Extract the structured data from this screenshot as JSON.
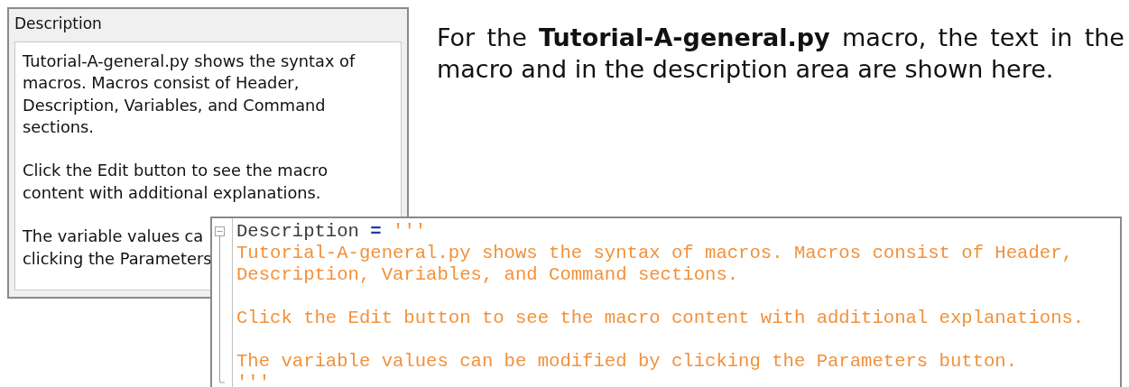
{
  "description_panel": {
    "title": "Description",
    "paragraphs": [
      [
        "Tutorial-A-general.py shows the syntax of",
        "macros. Macros consist of Header,",
        "Description, Variables, and Command",
        "sections."
      ],
      [
        "Click the Edit button to see the macro",
        "content with additional explanations."
      ],
      [
        "The variable values ca",
        "clicking the Parameters"
      ]
    ]
  },
  "caption": "For the **Tutorial-A-general.py** macro, the text in the macro and in the description area are shown here.",
  "code_editor": {
    "tokens": [
      {
        "kind": "identifier",
        "text": "Description"
      },
      {
        "kind": "operator",
        "text": "="
      },
      {
        "kind": "string",
        "text": "'''"
      }
    ],
    "string_paragraphs": [
      [
        "Tutorial-A-general.py shows the syntax of macros. Macros consist of Header,",
        "Description, Variables, and Command sections."
      ],
      [
        "Click the Edit button to see the macro content with additional explanations."
      ],
      [
        "The variable values can be modified by clicking the Parameters button."
      ]
    ],
    "string_close": "'''"
  }
}
